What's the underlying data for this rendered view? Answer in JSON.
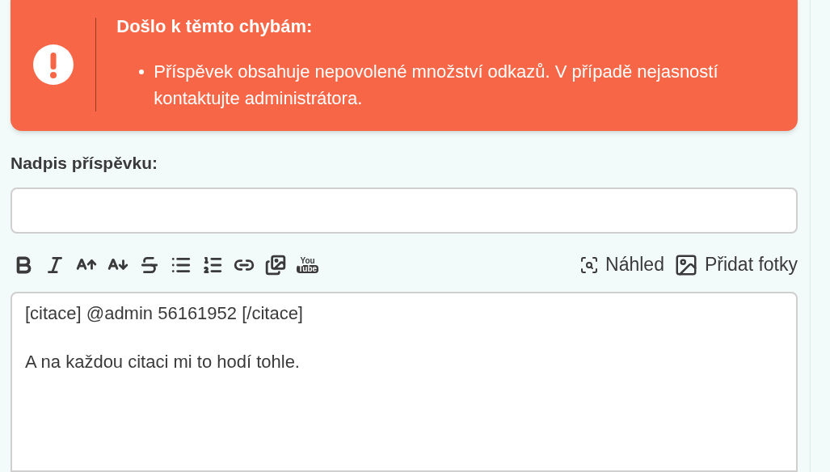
{
  "error_alert": {
    "title": "Došlo k těmto chybám:",
    "messages": [
      "Příspěvek obsahuje nepovolené množství odkazů. V případě nejasností kontaktujte administrátora."
    ]
  },
  "title_field": {
    "label": "Nadpis příspěvku:"
  },
  "toolbar": [
    {
      "kind": "bold"
    },
    {
      "kind": "italic"
    },
    {
      "kind": "font-up"
    },
    {
      "kind": "font-down"
    },
    {
      "kind": "strike"
    },
    {
      "kind": "bullets"
    },
    {
      "kind": "numbers"
    },
    {
      "kind": "link"
    },
    {
      "kind": "image-link"
    },
    {
      "kind": "video",
      "label_top": "You",
      "label_bottom": "Tube"
    }
  ],
  "actions": [
    {
      "kind": "preview",
      "label": "Náhled"
    },
    {
      "kind": "photos",
      "label": "Přidat fotky"
    }
  ],
  "editor": {
    "paragraphs": [
      "[citace] @admin 56161952 [/citace]",
      "A na každou citaci mi to hodí tohle."
    ]
  }
}
